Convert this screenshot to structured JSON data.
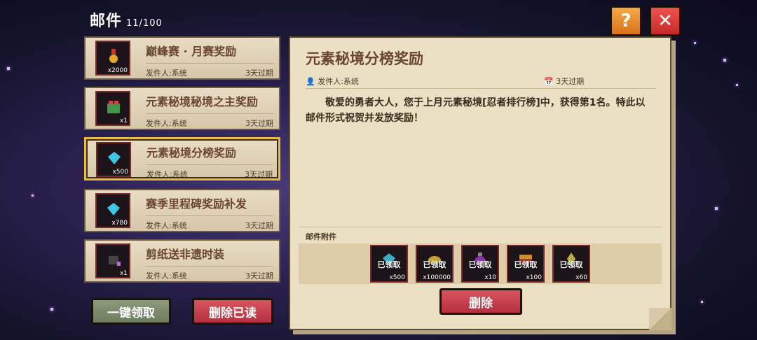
{
  "header": {
    "title": "邮件",
    "count": "11/100",
    "help_label": "?",
    "close_label": "✕"
  },
  "colors": {
    "accent_gold": "#e6bd3c",
    "danger": "#c62a28",
    "help": "#d8711b"
  },
  "mails": [
    {
      "title": "巅峰赛 · 月赛奖励",
      "sender": "发件人:系统",
      "expire": "3天过期",
      "count": "x2000",
      "icon": "medal-icon"
    },
    {
      "title": "元素秘境秘境之主奖励",
      "sender": "发件人:系统",
      "expire": "3天过期",
      "count": "x1",
      "icon": "frog-avatar-icon"
    },
    {
      "title": "元素秘境分榜奖励",
      "sender": "发件人:系统",
      "expire": "3天过期",
      "count": "x500",
      "icon": "diamond-icon",
      "selected": true
    },
    {
      "title": "赛季里程碑奖励补发",
      "sender": "发件人:系统",
      "expire": "3天过期",
      "count": "x780",
      "icon": "diamond-icon"
    },
    {
      "title": "剪纸送非遗时装",
      "sender": "发件人:系统",
      "expire": "3天过期",
      "count": "x1",
      "icon": "costume-icon"
    }
  ],
  "buttons": {
    "claim_all": "一键领取",
    "delete_read": "删除已读",
    "delete": "删除"
  },
  "detail": {
    "title": "元素秘境分榜奖励",
    "sender": "发件人:系统",
    "expire": "3天过期",
    "body": "敬爱的勇者大人，您于上月元素秘境[忍者排行榜]中，获得第1名。特此以邮件形式祝贺并发放奖励！",
    "attachments_label": "邮件附件",
    "attachments": [
      {
        "status": "已领取",
        "count": "x500",
        "icon": "diamond-icon"
      },
      {
        "status": "已领取",
        "count": "x100000",
        "icon": "gold-coin-icon"
      },
      {
        "status": "已领取",
        "count": "x10",
        "icon": "potion-icon"
      },
      {
        "status": "已领取",
        "count": "x100",
        "icon": "chest-icon"
      },
      {
        "status": "已领取",
        "count": "x60",
        "icon": "crystal-icon"
      }
    ]
  }
}
